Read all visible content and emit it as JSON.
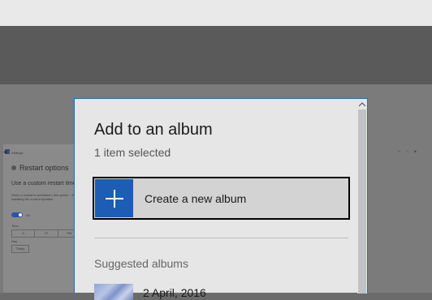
{
  "background": {
    "settings_title": "Settings",
    "heading": "Restart options",
    "subheading": "Use a custom restart time",
    "paragraph": "When a restart is scheduled, this option... then installing the current updates",
    "toggle_label": "On",
    "time_label": "Time",
    "time": [
      "5",
      "27",
      "PM"
    ],
    "day_label": "Day",
    "day_value": "Today"
  },
  "dialog": {
    "title": "Add to an album",
    "subtitle": "1 item selected",
    "create_label": "Create a new album",
    "suggested_header": "Suggested albums",
    "albums": [
      {
        "label": "2 April, 2016"
      }
    ]
  },
  "colors": {
    "accent": "#1d5db5",
    "dialog_border": "#2b6cc0",
    "dialog_bg": "#e6e6e6"
  }
}
